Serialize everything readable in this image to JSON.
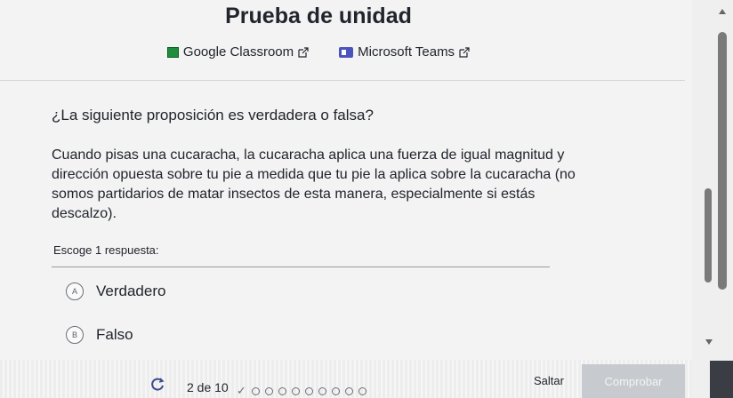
{
  "page": {
    "title": "Prueba de unidad"
  },
  "share": {
    "google_classroom": "Google Classroom",
    "microsoft_teams": "Microsoft Teams",
    "icons": [
      "google-classroom-icon",
      "external-link-icon",
      "microsoft-teams-icon"
    ]
  },
  "question": {
    "prompt": "¿La siguiente proposición es verdadera o falsa?",
    "body": "Cuando pisas una cucaracha, la cucaracha aplica una fuerza de igual magnitud y dirección opuesta sobre tu pie a medida que tu pie la aplica sobre la cucaracha (no somos partidarios de matar insectos de esta manera, especialmente si estás descalzo).",
    "choose_label": "Escoge 1 respuesta:",
    "choices": [
      {
        "letter": "A",
        "label": "Verdadero"
      },
      {
        "letter": "B",
        "label": "Falso"
      }
    ]
  },
  "footer": {
    "progress": "2 de 10",
    "current_question": 2,
    "total_questions": 10,
    "skip_label": "Saltar",
    "check_label": "Comprobar"
  },
  "colors": {
    "text": "#21242c",
    "check_button": "#c7cacf",
    "classroom": "#1e8e3e",
    "teams": "#4b53bc"
  }
}
